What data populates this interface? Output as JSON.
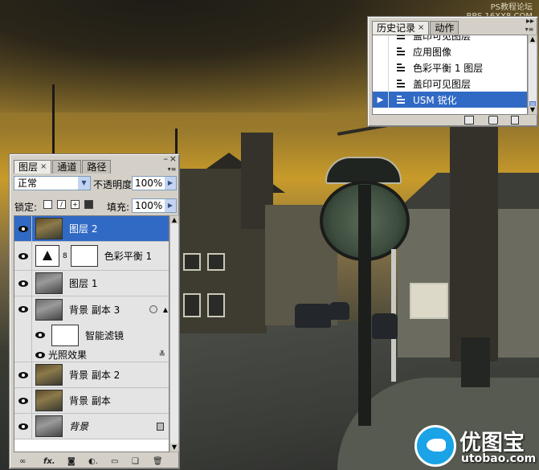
{
  "watermark": {
    "top_line1": "PS教程论坛",
    "top_line2": "BBS.16XX8.COM",
    "logo_main": "优图宝",
    "logo_sub": "utobao.com"
  },
  "history_panel": {
    "tabs": [
      {
        "label": "历史记录",
        "close": "×",
        "active": true
      },
      {
        "label": "动作",
        "active": false
      }
    ],
    "items": [
      {
        "label": "盖印可见图层",
        "selected": false
      },
      {
        "label": "应用图像",
        "selected": false
      },
      {
        "label": "色彩平衡 1 图层",
        "selected": false
      },
      {
        "label": "盖印可见图层",
        "selected": false
      },
      {
        "label": "USM 锐化",
        "selected": true
      }
    ],
    "footer_icons": [
      "new-snapshot-icon",
      "camera-icon",
      "trash-icon"
    ]
  },
  "layers_panel": {
    "tabs": [
      {
        "label": "图层",
        "close": "×",
        "active": true
      },
      {
        "label": "通道",
        "active": false
      },
      {
        "label": "路径",
        "active": false
      }
    ],
    "blend_mode": "正常",
    "opacity_label": "不透明度:",
    "opacity_value": "100%",
    "lock_label": "锁定:",
    "fill_label": "填充:",
    "fill_value": "100%",
    "layers": [
      {
        "name": "图层 2",
        "type": "photo",
        "selected": true
      },
      {
        "name": "色彩平衡 1",
        "type": "adjustment",
        "selected": false
      },
      {
        "name": "图层 1",
        "type": "photo",
        "selected": false
      },
      {
        "name": "背景 副本 3",
        "type": "smart",
        "selected": false
      },
      {
        "name": "智能滤镜",
        "type": "filter-mask",
        "selected": false
      },
      {
        "name": "光照效果",
        "type": "filter",
        "selected": false
      },
      {
        "name": "背景 副本 2",
        "type": "photo",
        "selected": false
      },
      {
        "name": "背景 副本",
        "type": "photo",
        "selected": false
      },
      {
        "name": "背景",
        "type": "background",
        "selected": false
      }
    ],
    "footer_icons": [
      "link-icon",
      "fx-icon",
      "mask-icon",
      "adjustment-icon",
      "folder-icon",
      "new-layer-icon",
      "trash-icon"
    ],
    "footer_fx_label": "fx."
  }
}
